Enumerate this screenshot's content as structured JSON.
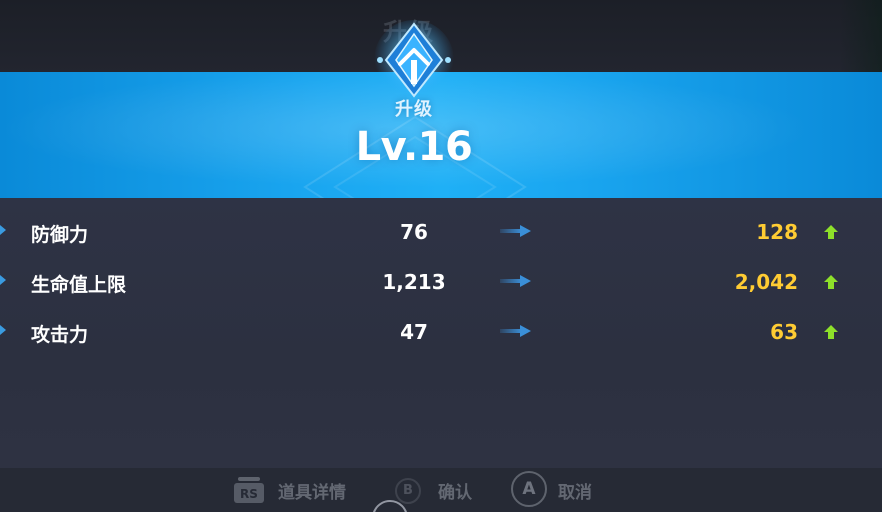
{
  "background": {
    "ghost_title": "升级"
  },
  "banner": {
    "subtitle": "升级",
    "level": "Lv.16",
    "color": "#1aa6f0"
  },
  "stats": [
    {
      "name": "防御力",
      "old": "76",
      "new": "128"
    },
    {
      "name": "生命值上限",
      "old": "1,213",
      "new": "2,042"
    },
    {
      "name": "攻击力",
      "old": "47",
      "new": "63"
    }
  ],
  "colors": {
    "new_value": "#ffcc33",
    "up_arrow": "#8ee02a",
    "arrow": "#3a8fd8"
  },
  "icons": {
    "row_arrow": "right-arrow-icon",
    "increase": "up-arrow-icon",
    "emblem": "ascension-emblem-icon"
  },
  "hints": {
    "details_label": "道具详情",
    "confirm_label": "确认",
    "cancel_button": "A",
    "cancel_label": "取消",
    "details_button": "RS",
    "confirm_button": "B"
  }
}
